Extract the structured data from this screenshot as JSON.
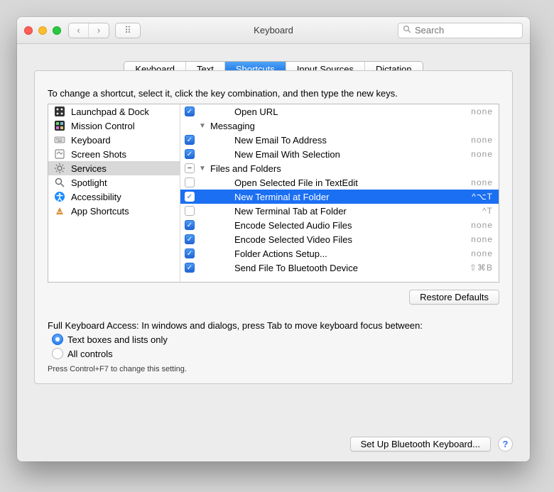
{
  "window_title": "Keyboard",
  "search": {
    "placeholder": "Search"
  },
  "tabs": [
    {
      "label": "Keyboard",
      "active": false
    },
    {
      "label": "Text",
      "active": false
    },
    {
      "label": "Shortcuts",
      "active": true
    },
    {
      "label": "Input Sources",
      "active": false
    },
    {
      "label": "Dictation",
      "active": false
    }
  ],
  "instruction": "To change a shortcut, select it, click the key combination, and then type the new keys.",
  "sidebar": {
    "items": [
      {
        "label": "Launchpad & Dock",
        "icon": "launchpad-icon"
      },
      {
        "label": "Mission Control",
        "icon": "mission-control-icon"
      },
      {
        "label": "Keyboard",
        "icon": "keyboard-icon"
      },
      {
        "label": "Screen Shots",
        "icon": "screenshot-icon"
      },
      {
        "label": "Services",
        "icon": "gear-icon",
        "selected": true
      },
      {
        "label": "Spotlight",
        "icon": "spotlight-icon"
      },
      {
        "label": "Accessibility",
        "icon": "accessibility-icon"
      },
      {
        "label": "App Shortcuts",
        "icon": "app-shortcuts-icon"
      }
    ]
  },
  "services": {
    "rows": [
      {
        "kind": "item",
        "checked": true,
        "label": "Open URL",
        "shortcut": "none",
        "indent": 1
      },
      {
        "kind": "group",
        "expanded": true,
        "label": "Messaging"
      },
      {
        "kind": "item",
        "checked": true,
        "label": "New Email To Address",
        "shortcut": "none",
        "indent": 1
      },
      {
        "kind": "item",
        "checked": true,
        "label": "New Email With Selection",
        "shortcut": "none",
        "indent": 1
      },
      {
        "kind": "group-collapse",
        "label": "Files and Folders"
      },
      {
        "kind": "item",
        "checked": false,
        "label": "Open Selected File in TextEdit",
        "shortcut": "none",
        "indent": 1
      },
      {
        "kind": "item",
        "checked": true,
        "label": "New Terminal at Folder",
        "shortcut": "^⌥T",
        "indent": 1,
        "selected": true
      },
      {
        "kind": "item",
        "checked": false,
        "label": "New Terminal Tab at Folder",
        "shortcut": "^T",
        "indent": 1
      },
      {
        "kind": "item",
        "checked": true,
        "label": "Encode Selected Audio Files",
        "shortcut": "none",
        "indent": 1
      },
      {
        "kind": "item",
        "checked": true,
        "label": "Encode Selected Video Files",
        "shortcut": "none",
        "indent": 1
      },
      {
        "kind": "item",
        "checked": true,
        "label": "Folder Actions Setup...",
        "shortcut": "none",
        "indent": 1
      },
      {
        "kind": "item",
        "checked": true,
        "label": "Send File To Bluetooth Device",
        "shortcut": "⇧⌘B",
        "indent": 1
      }
    ]
  },
  "restore_button": "Restore Defaults",
  "fka": {
    "heading": "Full Keyboard Access: In windows and dialogs, press Tab to move keyboard focus between:",
    "options": [
      {
        "label": "Text boxes and lists only",
        "selected": true
      },
      {
        "label": "All controls",
        "selected": false
      }
    ],
    "note": "Press Control+F7 to change this setting."
  },
  "footer_button": "Set Up Bluetooth Keyboard..."
}
